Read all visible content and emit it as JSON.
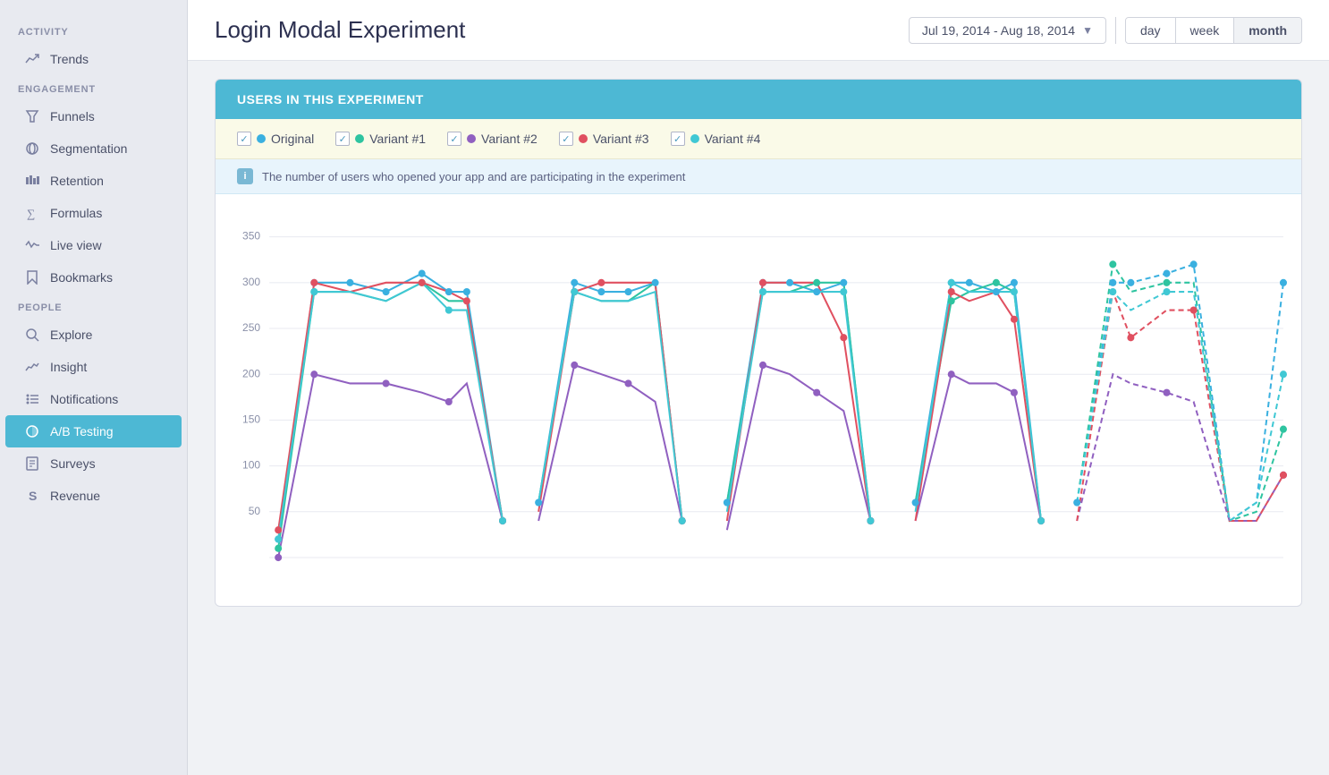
{
  "sidebar": {
    "activity_label": "ACTIVITY",
    "engagement_label": "ENGAGEMENT",
    "people_label": "PEOPLE",
    "items": {
      "trends": "Trends",
      "funnels": "Funnels",
      "segmentation": "Segmentation",
      "retention": "Retention",
      "formulas": "Formulas",
      "live_view": "Live view",
      "bookmarks": "Bookmarks",
      "explore": "Explore",
      "insight": "Insight",
      "notifications": "Notifications",
      "ab_testing": "A/B Testing",
      "surveys": "Surveys",
      "revenue": "Revenue"
    }
  },
  "header": {
    "title": "Login Modal Experiment",
    "date_range": "Jul 19, 2014 - Aug 18, 2014",
    "time_buttons": [
      "day",
      "week",
      "month"
    ],
    "active_time": "month"
  },
  "chart": {
    "section_title": "USERS IN THIS EXPERIMENT",
    "info_text": "The number of users who opened your app and are participating in the experiment",
    "legend": [
      {
        "label": "Original",
        "color": "#3ab0e0",
        "checked": true
      },
      {
        "label": "Variant #1",
        "color": "#2ec4a0",
        "checked": true
      },
      {
        "label": "Variant #2",
        "color": "#9060c0",
        "checked": true
      },
      {
        "label": "Variant #3",
        "color": "#e05060",
        "checked": true
      },
      {
        "label": "Variant #4",
        "color": "#40c8d4",
        "checked": true
      }
    ],
    "y_axis": [
      350,
      300,
      250,
      200,
      150,
      100,
      50
    ],
    "colors": {
      "original": "#3ab0e0",
      "variant1": "#2ec4a0",
      "variant2": "#9060c0",
      "variant3": "#e05060",
      "variant4": "#40c8d4"
    }
  }
}
